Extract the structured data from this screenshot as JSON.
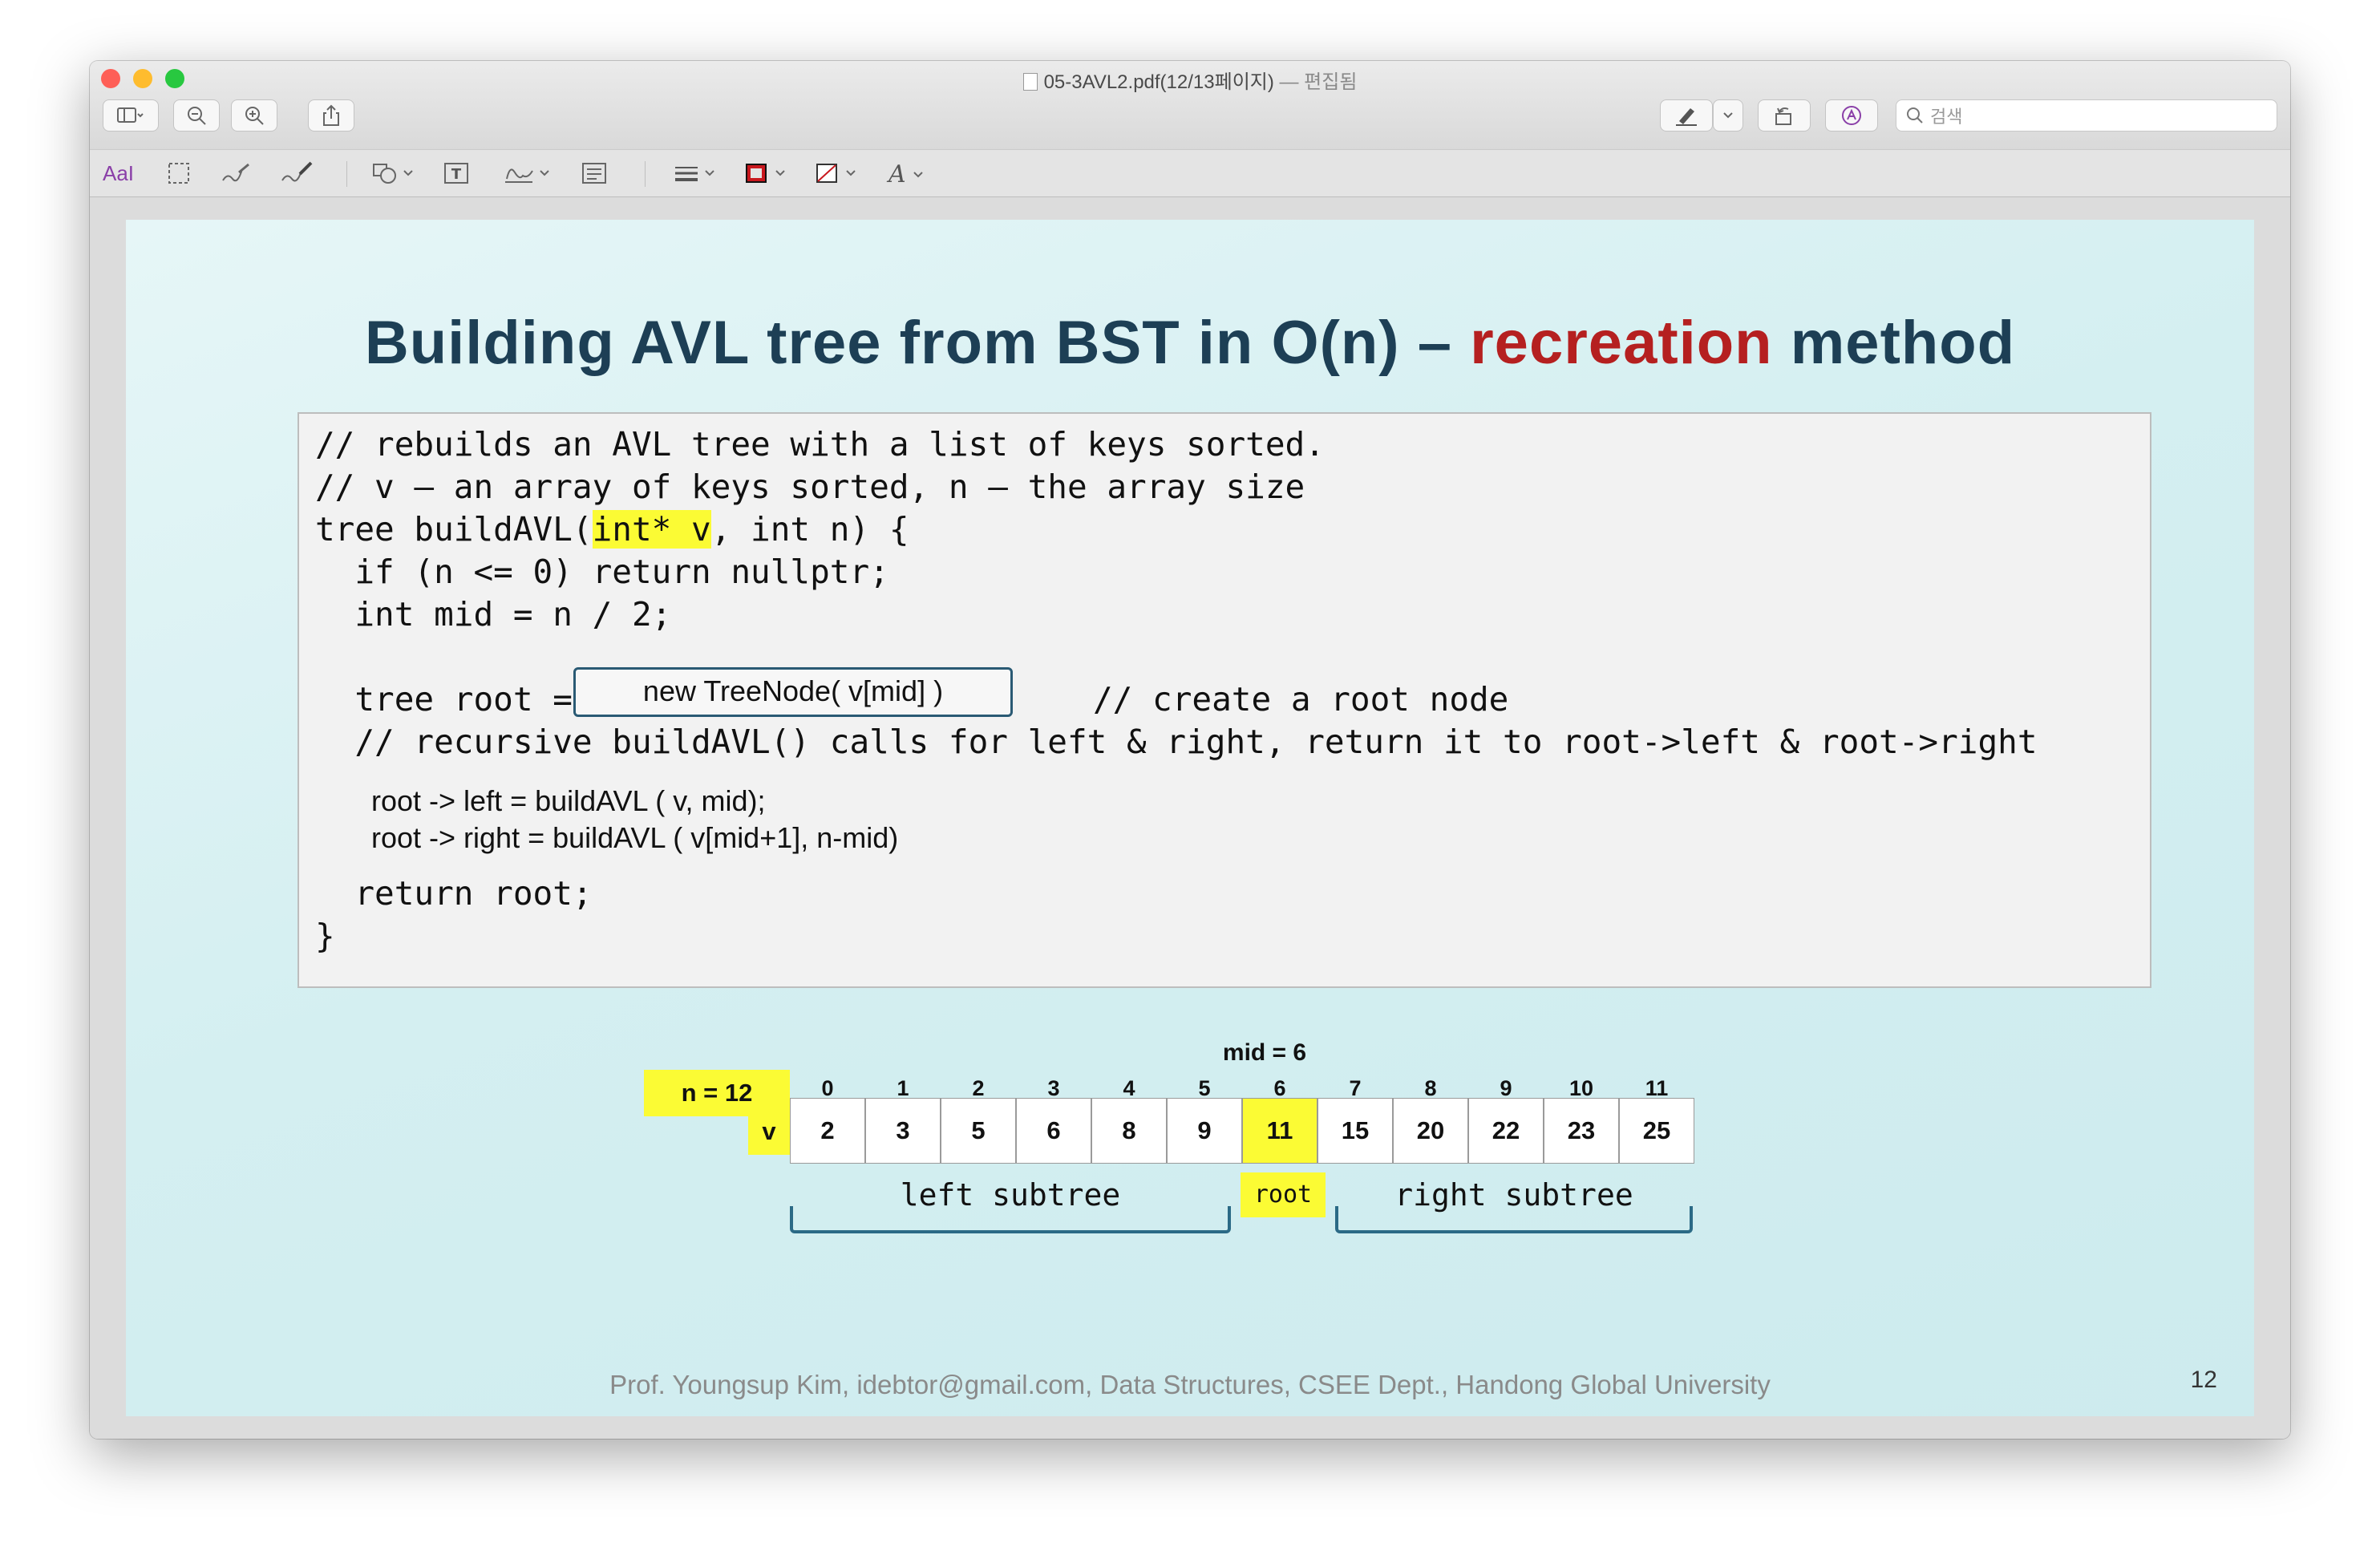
{
  "window": {
    "title": "05-3AVL2.pdf(12/13페이지)",
    "edited": "— 편집됨",
    "colors": {
      "close": "#fe5f57",
      "minimize": "#febc2e",
      "zoom": "#28c840"
    }
  },
  "toolbar": {
    "search_placeholder": "검색",
    "icons": [
      "sidebar-icon",
      "zoom-out-icon",
      "zoom-in-icon",
      "share-icon",
      "highlight-pen-icon",
      "rotate-icon",
      "markup-icon",
      "search-icon"
    ]
  },
  "markup_toolbar": {
    "text_style": "AaI",
    "text_icon": "T",
    "font_icon": "A"
  },
  "slide": {
    "title_part1": "Building AVL tree from BST in O(n) – ",
    "title_part2": "recreation",
    "title_part3": " method",
    "code": {
      "line1": "// rebuilds an AVL tree with a list of keys sorted.",
      "line2": "// v – an array of keys sorted, n – the array size",
      "line3_a": "tree buildAVL(",
      "line3_hl": "int* v",
      "line3_b": ", int n) {",
      "line4": "  if (n <= 0) return nullptr;",
      "line5": "  int mid = n / 2;",
      "line6_a": "  tree root =",
      "line6_box": "new TreeNode( v[mid] )",
      "line6_comment": "// create a root node",
      "line7": "  // recursive buildAVL() calls for left & right, return it to root->left & root->right",
      "line8": "root -> left = buildAVL ( v, mid);",
      "line9": "root -> right = buildAVL ( v[mid+1], n-mid)",
      "line10": "  return root;",
      "line11": "}"
    },
    "array": {
      "mid_label": "mid = 6",
      "n_label": "n = 12",
      "v_label": "v",
      "indices": [
        "0",
        "1",
        "2",
        "3",
        "4",
        "5",
        "6",
        "7",
        "8",
        "9",
        "10",
        "11"
      ],
      "values": [
        "2",
        "3",
        "5",
        "6",
        "8",
        "9",
        "11",
        "15",
        "20",
        "22",
        "23",
        "25"
      ],
      "highlight_index": 6,
      "highlight_color": "#fbfb34",
      "left_label": "left subtree",
      "root_label": "root",
      "right_label": "right subtree"
    },
    "footer": "Prof. Youngsup Kim, idebtor@gmail.com,  Data Structures, CSEE Dept., Handong Global University",
    "page_number": "12"
  }
}
